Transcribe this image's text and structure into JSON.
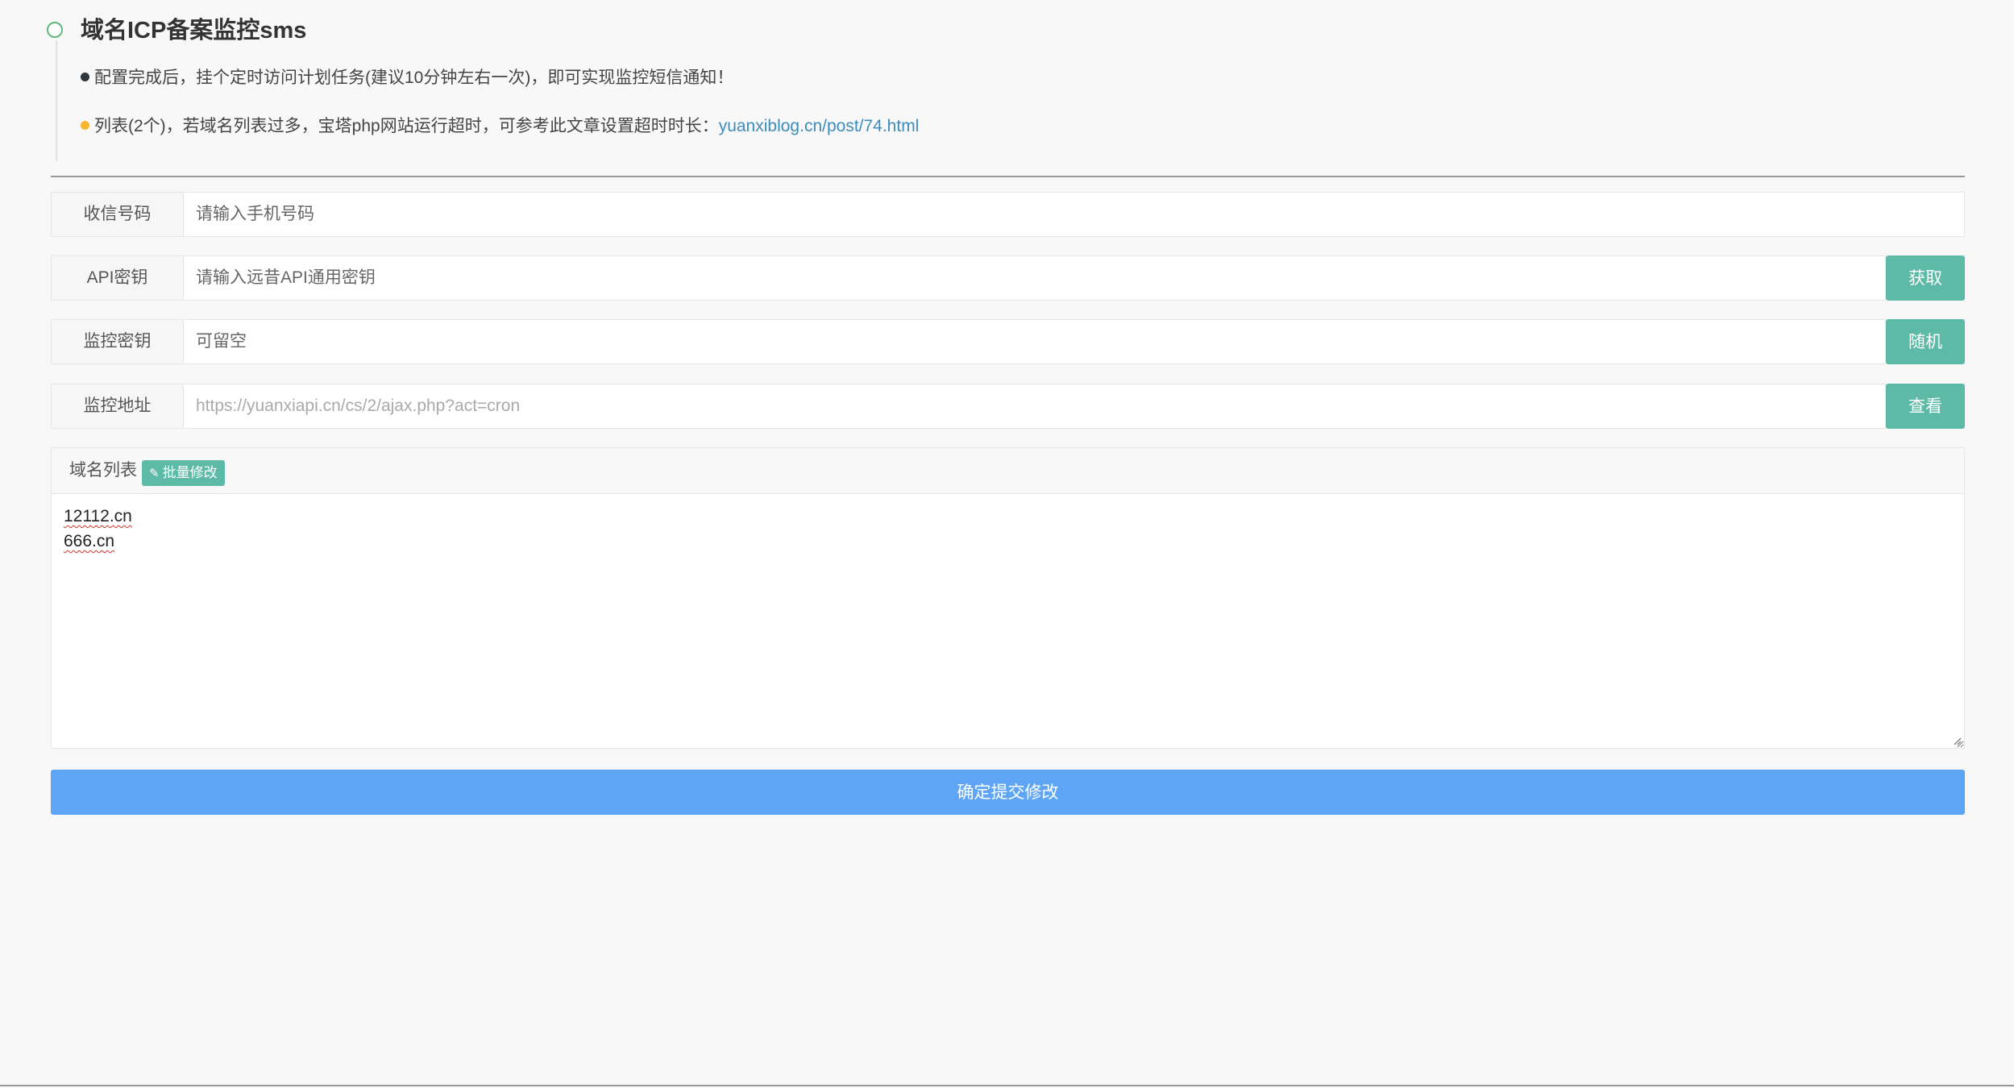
{
  "header": {
    "title": "域名ICP备案监控sms",
    "note1": "配置完成后，挂个定时访问计划任务(建议10分钟左右一次)，即可实现监控短信通知！",
    "note2_prefix": "列表(2个)，若域名列表过多，宝塔php网站运行超时，可参考此文章设置超时时长：",
    "note2_link": "yuanxiblog.cn/post/74.html"
  },
  "form": {
    "phone": {
      "label": "收信号码",
      "placeholder": "请输入手机号码"
    },
    "api": {
      "label": "API密钥",
      "placeholder": "请输入远昔API通用密钥",
      "button": "获取"
    },
    "monitor_key": {
      "label": "监控密钥",
      "placeholder": "可留空",
      "button": "随机"
    },
    "monitor_url": {
      "label": "监控地址",
      "placeholder": "https://yuanxiapi.cn/cs/2/ajax.php?act=cron",
      "button": "查看"
    }
  },
  "domains": {
    "label": "域名列表",
    "batch_button": "批量修改",
    "items": [
      "12112.cn",
      "666.cn"
    ]
  },
  "submit_label": "确定提交修改",
  "colors": {
    "teal_button": "#5dbaa7",
    "submit_blue": "#5fa5f6",
    "link_blue": "#3c8dbc",
    "timeline_green": "#5fb878",
    "dot_orange": "#f7b531"
  }
}
